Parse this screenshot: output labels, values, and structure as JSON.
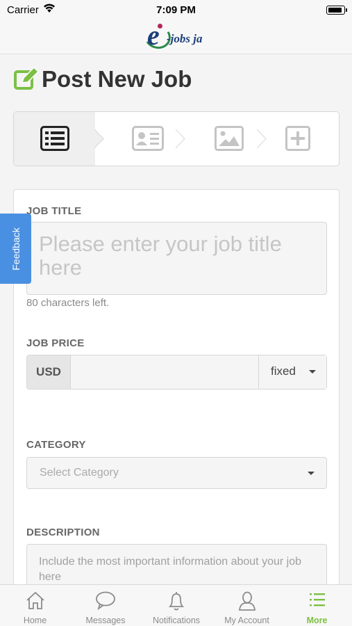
{
  "status_bar": {
    "carrier": "Carrier",
    "time": "7:09 PM"
  },
  "header": {
    "logo_letter": "e",
    "logo_text": "-jobs ja"
  },
  "page": {
    "title": "Post New Job",
    "accent_color": "#7cc043"
  },
  "steps": [
    {
      "icon": "list-icon",
      "active": true
    },
    {
      "icon": "id-card-icon",
      "active": false
    },
    {
      "icon": "image-icon",
      "active": false
    },
    {
      "icon": "plus-square-icon",
      "active": false
    }
  ],
  "form": {
    "job_title": {
      "label": "JOB TITLE",
      "placeholder": "Please enter your job title here",
      "helper": "80 characters left."
    },
    "job_price": {
      "label": "JOB PRICE",
      "currency": "USD",
      "value": "",
      "price_type": "fixed"
    },
    "category": {
      "label": "CATEGORY",
      "placeholder": "Select Category"
    },
    "description": {
      "label": "DESCRIPTION",
      "placeholder": "Include the most important information about your job here"
    }
  },
  "feedback": {
    "label": "Feedback",
    "color": "#4a90e2"
  },
  "tabbar": {
    "items": [
      {
        "label": "Home",
        "icon": "home-icon"
      },
      {
        "label": "Messages",
        "icon": "chat-bubble-icon"
      },
      {
        "label": "Notifications",
        "icon": "bell-icon"
      },
      {
        "label": "My Account",
        "icon": "user-icon"
      },
      {
        "label": "More",
        "icon": "menu-list-icon",
        "active": true
      }
    ]
  }
}
